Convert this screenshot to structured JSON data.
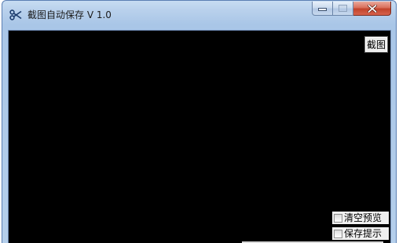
{
  "window": {
    "title": "截图自动保存 V 1.0"
  },
  "titlebar": {
    "app_icon": "scissors-icon",
    "minimize_icon": "minimize-icon",
    "maximize_icon": "maximize-icon",
    "close_icon": "close-icon"
  },
  "toolbar": {
    "capture_label": "截图"
  },
  "options": {
    "clear_preview_label": "清空预览",
    "save_prompt_label": "保存提示",
    "clear_preview_checked": false,
    "save_prompt_checked": false
  },
  "colors": {
    "preview_background": "#000000",
    "titlebar": "#b9d1ec",
    "close_button": "#c7432b"
  }
}
